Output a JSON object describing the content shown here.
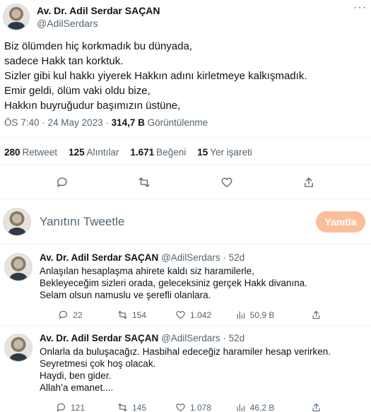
{
  "tweet": {
    "display_name": "Av. Dr. Adil Serdar SAÇAN",
    "handle": "@AdilSerdars",
    "more": "···",
    "text": "Biz ölümden hiç korkmadık bu dünyada,\nsadece Hakk tan korktuk.\nSizler gibi kul hakkı yiyerek Hakkın adını kirletmeye kalkışmadık.\nEmir geldi, ölüm vaki oldu bize,\nHakkın buyruğudur başımızın üstüne,",
    "time": "ÖS 7:40 · 24 May 2023 · ",
    "views_count": "314,7 B",
    "views_label": " Görüntülenme",
    "stats": {
      "retweets_count": "280",
      "retweets_label": "Retweet",
      "quotes_count": "125",
      "quotes_label": "Alıntılar",
      "likes_count": "1.671",
      "likes_label": "Beğeni",
      "bookmarks_count": "15",
      "bookmarks_label": "Yer işareti"
    }
  },
  "composer": {
    "placeholder": "Yanıtını Tweetle",
    "button": "Yanıtla"
  },
  "replies": [
    {
      "display_name": "Av. Dr. Adil Serdar SAÇAN",
      "handle": "@AdilSerdars",
      "age": "· 52d",
      "text": "Anlaşılan hesaplaşma ahirete kaldı siz haramilerle,\nBekleyeceğim sizleri orada, geleceksiniz gerçek Hakk divanına.\nSelam olsun namuslu ve şerefli olanlara.",
      "replies": "22",
      "retweets": "154",
      "likes": "1.042",
      "views": "50,9 B"
    },
    {
      "display_name": "Av. Dr. Adil Serdar SAÇAN",
      "handle": "@AdilSerdars",
      "age": "· 52d",
      "text": "Onlarla da buluşacağız. Hasbihal edeceğiz haramiler hesap verirken. Seyretmesi çok hoş olacak.\nHaydi, ben gider.\nAllah’a emanet....",
      "replies": "121",
      "retweets": "145",
      "likes": "1.078",
      "views": "46,2 B"
    }
  ],
  "icons": [
    "reply-icon",
    "retweet-icon",
    "like-icon",
    "share-icon",
    "views-icon",
    "more-icon"
  ]
}
